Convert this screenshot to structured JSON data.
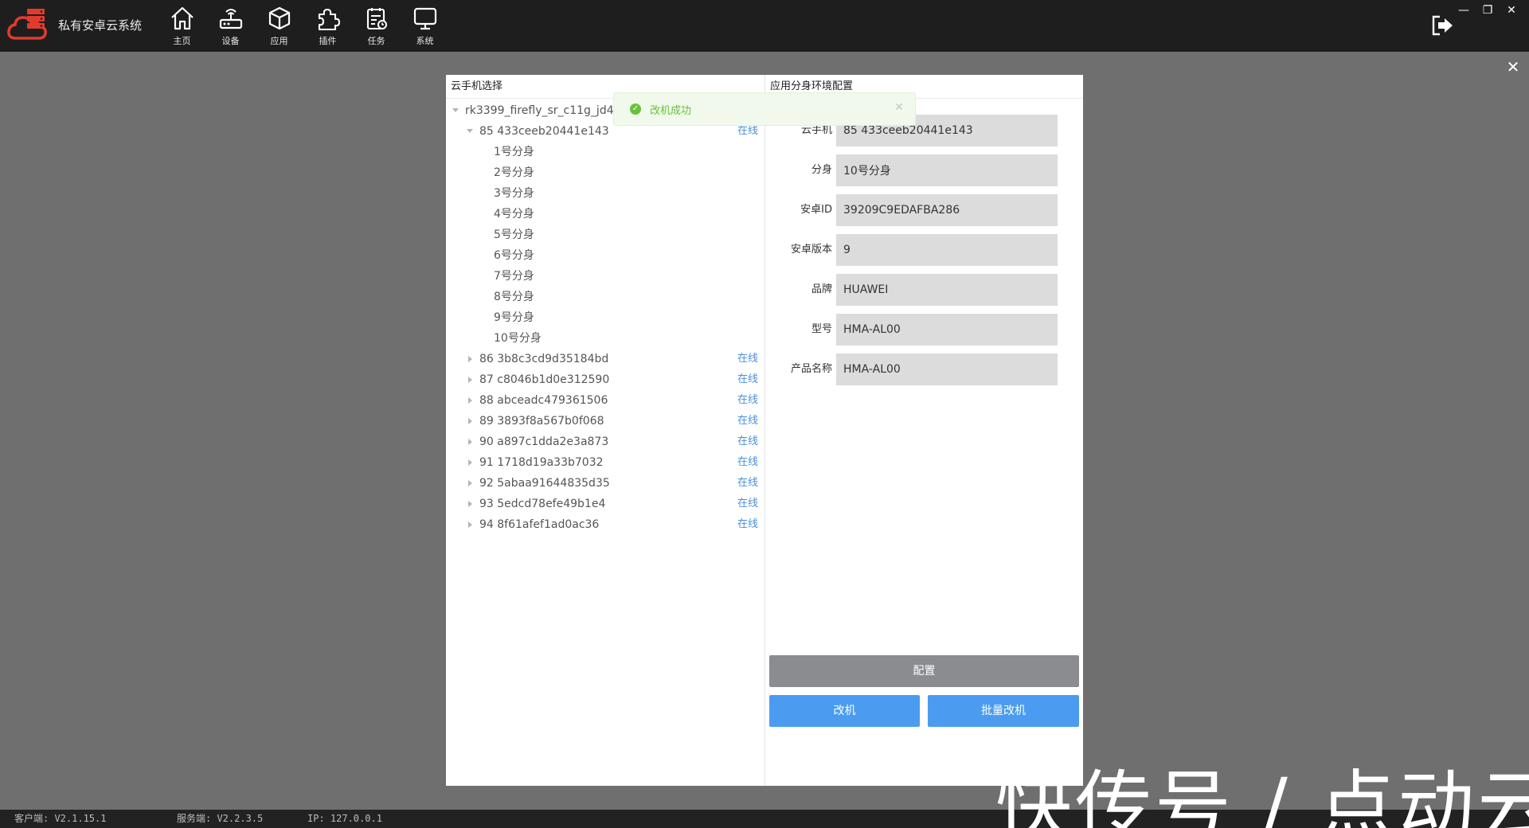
{
  "app": {
    "title": "私有安卓云系统",
    "nav": [
      {
        "label": "主页",
        "icon": "home-icon"
      },
      {
        "label": "设备",
        "icon": "router-icon"
      },
      {
        "label": "应用",
        "icon": "cube-icon"
      },
      {
        "label": "插件",
        "icon": "puzzle-icon"
      },
      {
        "label": "任务",
        "icon": "task-icon"
      },
      {
        "label": "系统",
        "icon": "monitor-icon"
      }
    ],
    "window_controls": {
      "minimize": "—",
      "restore": "❐",
      "close": "✕"
    },
    "page_close": "✕"
  },
  "left_panel": {
    "title": "云手机选择",
    "root": "rk3399_firefly_sr_c11g_jd4",
    "expanded_device": {
      "label": "85 433ceeb20441e143",
      "status": "在线"
    },
    "clones": [
      "1号分身",
      "2号分身",
      "3号分身",
      "4号分身",
      "5号分身",
      "6号分身",
      "7号分身",
      "8号分身",
      "9号分身",
      "10号分身"
    ],
    "devices": [
      {
        "label": "86 3b8c3cd9d35184bd",
        "status": "在线"
      },
      {
        "label": "87 c8046b1d0e312590",
        "status": "在线"
      },
      {
        "label": "88 abceadc479361506",
        "status": "在线"
      },
      {
        "label": "89 3893f8a567b0f068",
        "status": "在线"
      },
      {
        "label": "90 a897c1dda2e3a873",
        "status": "在线"
      },
      {
        "label": "91 1718d19a33b7032",
        "status": "在线"
      },
      {
        "label": "92 5abaa91644835d35",
        "status": "在线"
      },
      {
        "label": "93 5edcd78efe49b1e4",
        "status": "在线"
      },
      {
        "label": "94 8f61afef1ad0ac36",
        "status": "在线"
      }
    ]
  },
  "right_panel": {
    "title": "应用分身环境配置",
    "fields": {
      "phone": {
        "label": "云手机",
        "value": "85 433ceeb20441e143"
      },
      "clone": {
        "label": "分身",
        "value": "10号分身"
      },
      "android_id": {
        "label": "安卓ID",
        "value": "39209C9EDAFBA286"
      },
      "android_version": {
        "label": "安卓版本",
        "value": "9"
      },
      "brand": {
        "label": "品牌",
        "value": "HUAWEI"
      },
      "model": {
        "label": "型号",
        "value": "HMA-AL00"
      },
      "product_name": {
        "label": "产品名称",
        "value": "HMA-AL00"
      }
    },
    "buttons": {
      "config": "配置",
      "change": "改机",
      "batch_change": "批量改机"
    }
  },
  "toast": {
    "message": "改机成功",
    "icon": "success-check-icon",
    "close": "✕"
  },
  "statusbar": {
    "client": "客户端: V2.1.15.1",
    "server": "服务端: V2.2.3.5",
    "ip": "IP: 127.0.0.1"
  },
  "watermark": "快传号 / 点动云",
  "colors": {
    "accent": "#4b9cf0",
    "success": "#67c23a",
    "online": "#4a90d9",
    "config_button": "#8a8c8f",
    "logo": "#e23b2e"
  }
}
